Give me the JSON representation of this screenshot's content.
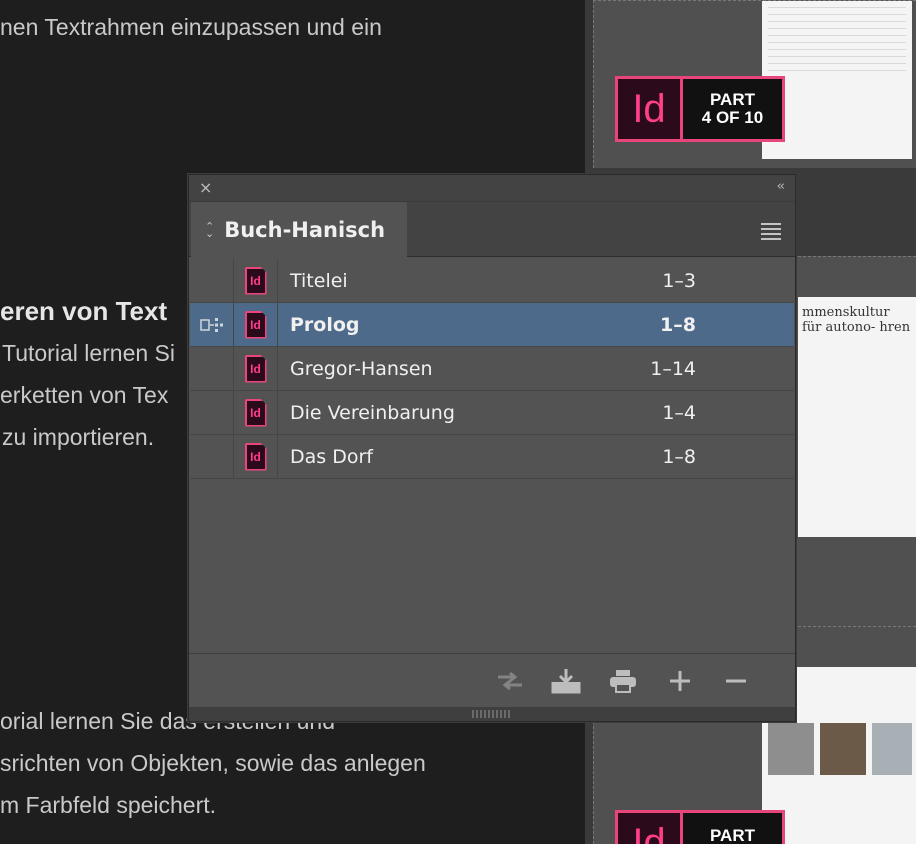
{
  "background_article": {
    "line1": "nen Textrahmen einzupassen und ein",
    "heading": "eren von Text",
    "line2": "Tutorial lernen Si",
    "line3": "erketten von Tex",
    "line4": "zu importieren.",
    "line5": "orial lernen Sie das erstellen und",
    "line6": "srichten von Objekten, sowie das anlegen",
    "line7": "m Farbfeld speichert."
  },
  "thumbnails": {
    "badge_top": {
      "logo": "Id",
      "part_line1": "PART",
      "part_line2": "4 OF 10"
    },
    "badge_bottom": {
      "logo": "Id",
      "part_line1": "PART"
    },
    "page_snippet": "mmenskultur für autono- hren"
  },
  "panel": {
    "close_icon": "×",
    "collapse_icon": "‹‹",
    "tab_label": "Buch-Hanisch",
    "menu_icon": "hamburger-menu",
    "documents": [
      {
        "name": "Titelei",
        "pages": "1–3",
        "selected": false
      },
      {
        "name": "Prolog",
        "pages": "1–8",
        "selected": true
      },
      {
        "name": "Gregor-Hansen",
        "pages": "1–14",
        "selected": false
      },
      {
        "name": "Die Vereinbarung",
        "pages": "1–4",
        "selected": false
      },
      {
        "name": "Das Dorf",
        "pages": "1–8",
        "selected": false
      }
    ],
    "doc_icon_label": "Id",
    "footer_buttons": [
      "synchronize",
      "save-book",
      "print-book",
      "add-document",
      "remove-document"
    ]
  },
  "colors": {
    "indesign_pink": "#e8457b",
    "selected_row": "#4e6a8a",
    "panel_bg": "#535353"
  }
}
